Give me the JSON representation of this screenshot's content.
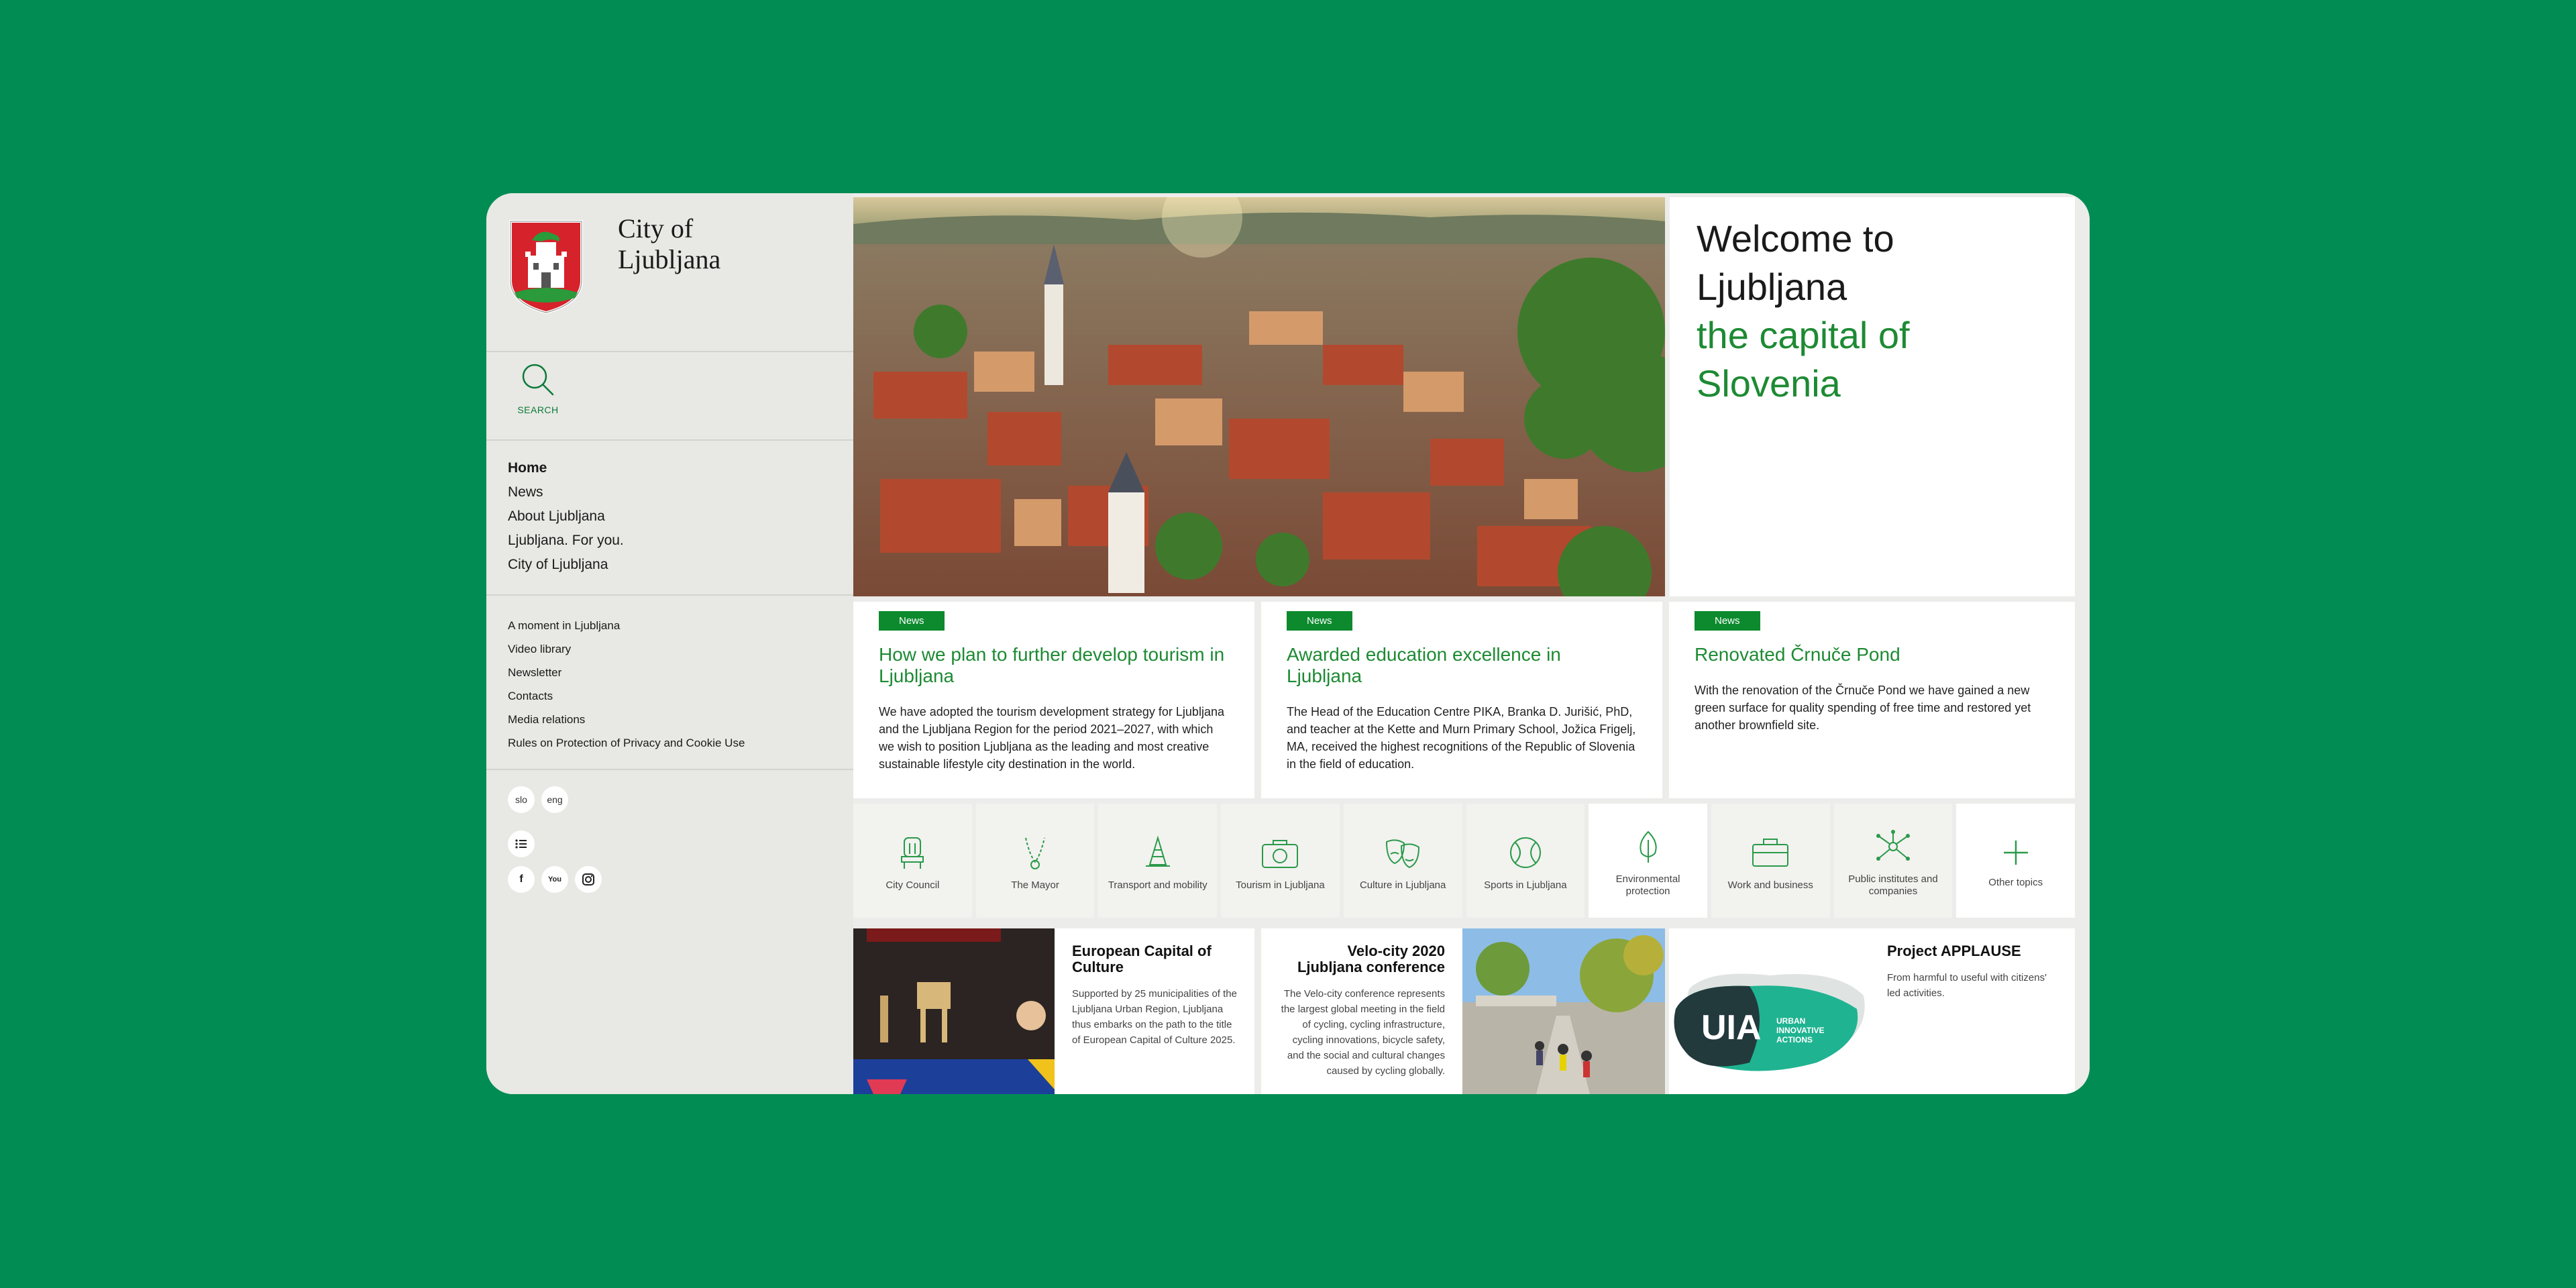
{
  "site": {
    "title": "City of\nLjubljana"
  },
  "search": {
    "label": "SEARCH"
  },
  "nav_primary": [
    {
      "label": "Home",
      "active": true
    },
    {
      "label": "News"
    },
    {
      "label": "About Ljubljana"
    },
    {
      "label": "Ljubljana. For you."
    },
    {
      "label": "City of Ljubljana"
    }
  ],
  "nav_secondary": [
    "A moment in Ljubljana",
    "Video library",
    "Newsletter",
    "Contacts",
    "Media relations",
    "Rules on Protection of Privacy and Cookie Use"
  ],
  "languages": [
    "slo",
    "eng"
  ],
  "social": [
    "f",
    "You",
    "ig"
  ],
  "welcome": {
    "line1": "Welcome to Ljubljana",
    "line2": "the capital of Slovenia"
  },
  "news": [
    {
      "tag": "News",
      "title": "How we plan to further develop tourism in Ljubljana",
      "body": "We have adopted the tourism development strategy for Ljubljana and the Ljubljana Region for the period 2021–2027, with which we wish to position Ljubljana as the leading and most creative sustainable lifestyle city destination in the world."
    },
    {
      "tag": "News",
      "title": "Awarded education excellence in Ljubljana",
      "body": "The Head of the Education Centre PIKA, Branka D. Jurišić, PhD, and teacher at the Kette and Murn Primary School, Jožica Frigelj, MA, received the highest recognitions of the Republic of Slovenia in the field of education."
    },
    {
      "tag": "News",
      "title": "Renovated Črnuče Pond",
      "body": "With the renovation of the Črnuče Pond we have gained a new green surface for quality spending of free time and restored yet another brownfield site."
    }
  ],
  "topics": [
    {
      "label": "City Council",
      "icon": "council-chair-icon"
    },
    {
      "label": "The Mayor",
      "icon": "mayor-chain-icon"
    },
    {
      "label": "Transport and mobility",
      "icon": "traffic-cone-icon"
    },
    {
      "label": "Tourism in Ljubljana",
      "icon": "camera-icon"
    },
    {
      "label": "Culture in Ljubljana",
      "icon": "theatre-masks-icon"
    },
    {
      "label": "Sports in Ljubljana",
      "icon": "ball-icon"
    },
    {
      "label": "Environmental protection",
      "icon": "leaf-icon"
    },
    {
      "label": "Work and business",
      "icon": "briefcase-icon"
    },
    {
      "label": "Public institutes and companies",
      "icon": "network-icon"
    },
    {
      "label": "Other topics",
      "icon": "plus-icon"
    }
  ],
  "cards": {
    "culture": {
      "title": "European Capital of Culture",
      "body": "Supported by 25 municipalities of the Ljubljana Urban Region, Ljubljana thus embarks on the path to the title of European Capital of Culture 2025."
    },
    "velocity": {
      "title": "Velo-city 2020 Ljubljana conference",
      "body": "The Velo-city conference represents the largest global meeting in the field of cycling, cycling infrastructure, cycling innovations, bicycle safety, and the social and cultural changes caused by cycling globally."
    },
    "applause": {
      "title": "Project APPLAUSE",
      "body": "From harmful to useful with citizens' led activities.",
      "logo_text": "UIA",
      "logo_sub": "URBAN INNOVATIVE ACTIONS"
    }
  },
  "colors": {
    "brand_green": "#008c53",
    "accent_green": "#1d8a33",
    "tag_green": "#0c8a2d"
  }
}
